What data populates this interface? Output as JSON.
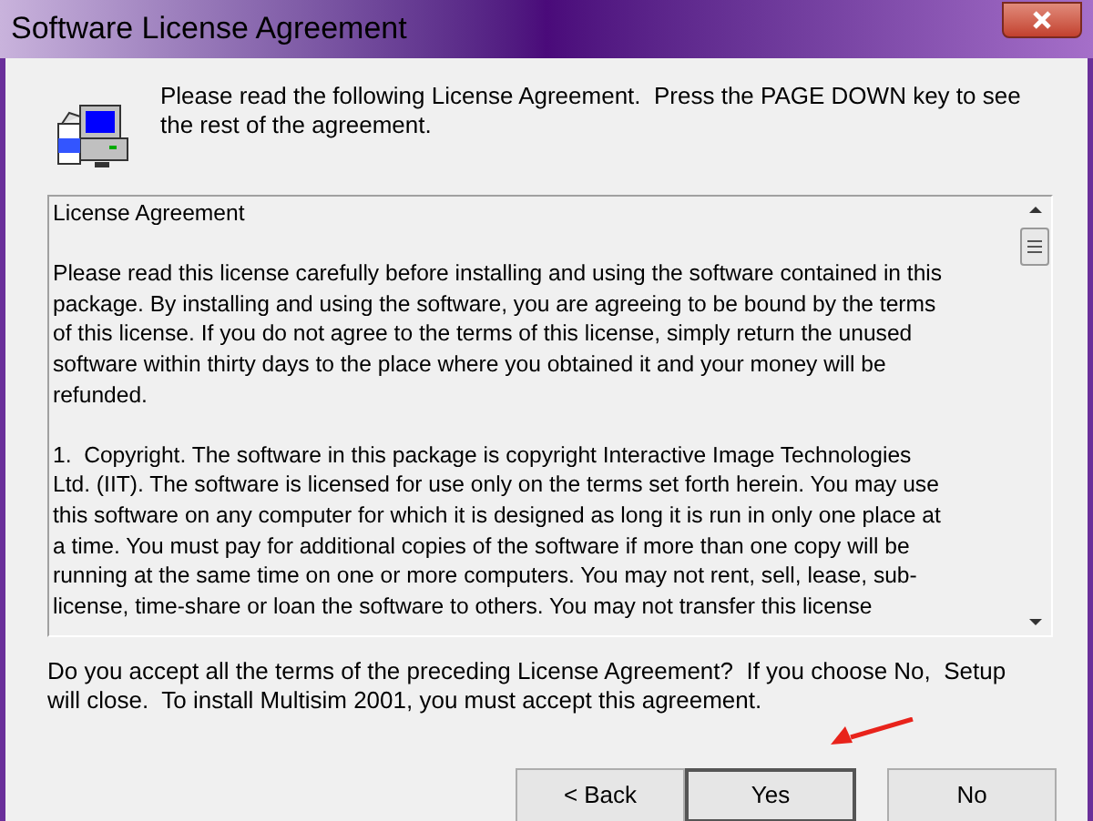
{
  "window": {
    "title": "Software License Agreement"
  },
  "instruction": [
    "Please read the following License Agreement.  Press the PAGE DOWN key to see",
    "the rest of the agreement."
  ],
  "license_text": [
    {
      "lines": [
        "License Agreement"
      ]
    },
    {
      "lines": [
        "Please read this license carefully before installing and using the software contained in this",
        "package. By installing and using the software, you are agreeing to be bound by the terms",
        "of this license. If you do not agree to the terms of this license, simply return the unused",
        "software within thirty days to the place where you obtained it and your money will be",
        "refunded."
      ]
    },
    {
      "lines": [
        "1.  Copyright. The software in this package is copyright Interactive Image Technologies",
        "Ltd. (IIT). The software is licensed for use only on the terms set forth herein. You may use",
        "this software on any computer for which it is designed as long it is run in only one place at",
        "a time. You must pay for additional copies of the software if more than one copy will be",
        "running at the same time on one or more computers. You may not rent, sell, lease, sub-",
        "license, time-share or loan the software to others. You may not transfer this license"
      ]
    }
  ],
  "question": [
    "Do you accept all the terms of the preceding License Agreement?  If you choose No,  Setup",
    "will close.  To install Multisim 2001, you must accept this agreement."
  ],
  "buttons": [
    {
      "label": "< Back",
      "default": false
    },
    {
      "label": "Yes",
      "default": true
    },
    {
      "label": "No",
      "default": false
    }
  ]
}
